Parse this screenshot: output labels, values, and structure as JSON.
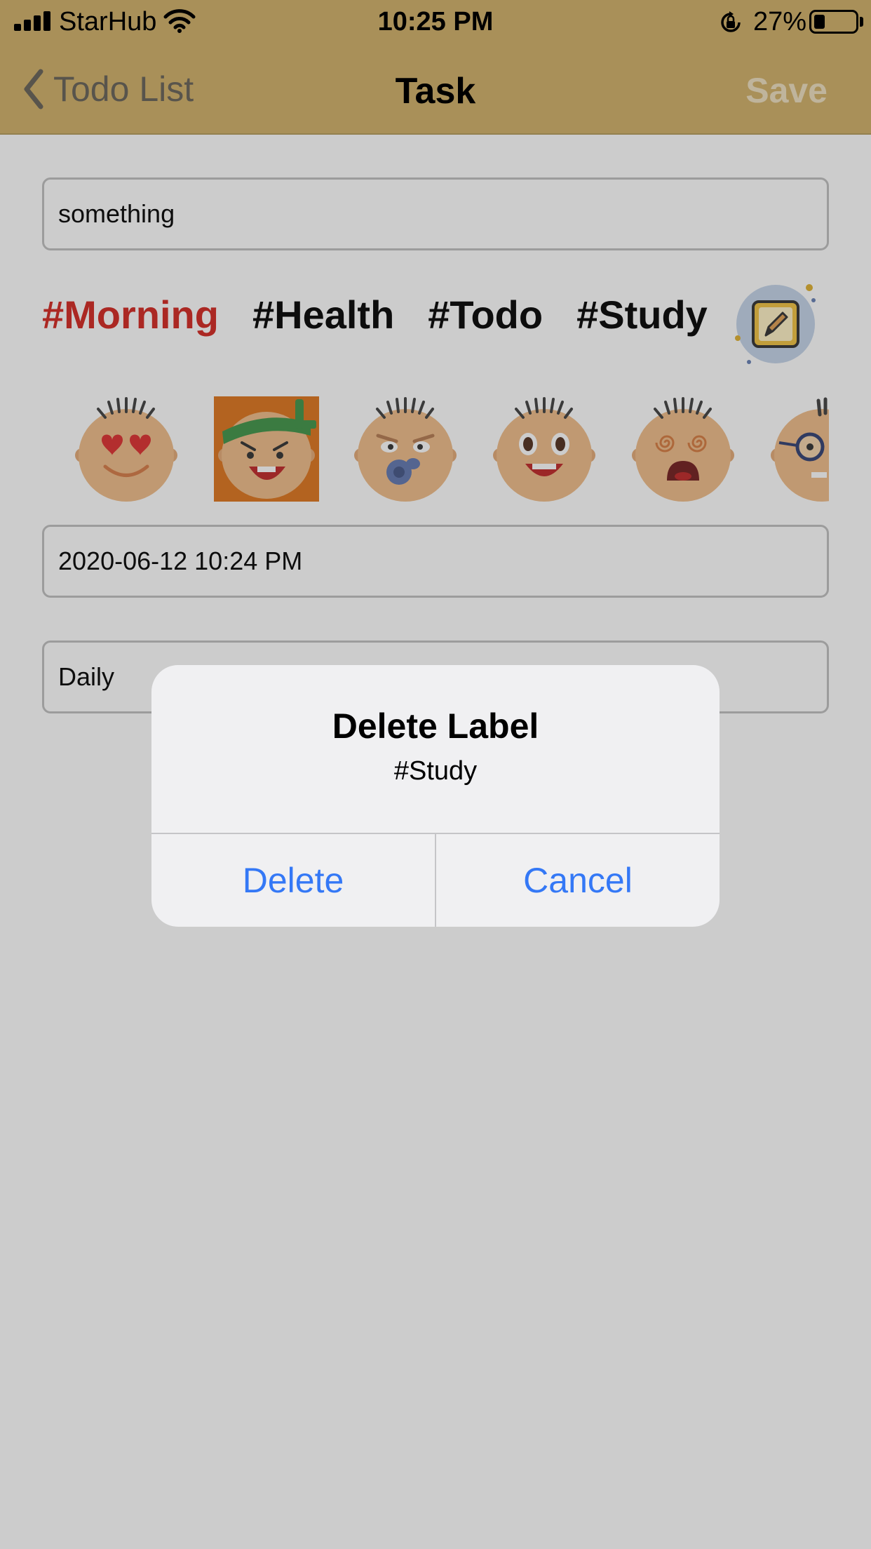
{
  "status_bar": {
    "carrier": "StarHub",
    "time": "10:25 PM",
    "battery_percent": "27%",
    "battery_level": 0.27
  },
  "nav": {
    "back_label": "Todo List",
    "title": "Task",
    "save_label": "Save"
  },
  "task": {
    "name_value": "something",
    "datetime_value": "2020-06-12 10:24 PM",
    "repeat_value": "Daily"
  },
  "labels": {
    "items": [
      "#Morning",
      "#Health",
      "#Todo",
      "#Study"
    ],
    "active": "#Morning"
  },
  "emojis": {
    "items": [
      "heart-eyes-face-icon",
      "headband-shouting-face-icon",
      "pacifier-face-icon",
      "surprised-face-icon",
      "dizzy-face-icon",
      "glasses-face-icon"
    ],
    "selected": "headband-shouting-face-icon"
  },
  "alert": {
    "title": "Delete Label",
    "message": "#Study",
    "delete_label": "Delete",
    "cancel_label": "Cancel"
  },
  "colors": {
    "header": "#d4b570",
    "active_tag": "#d6322c",
    "alert_button": "#3478f6",
    "selected_emoji_bg": "#e07c28"
  }
}
